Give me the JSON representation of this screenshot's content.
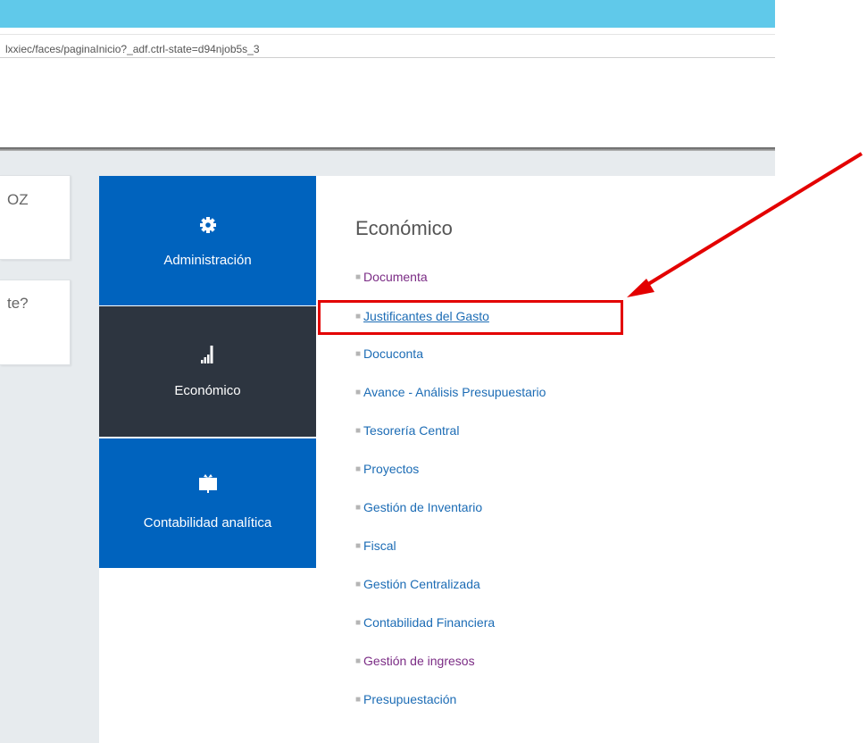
{
  "browser": {
    "url": "lxxiec/faces/paginaInicio?_adf.ctrl-state=d94njob5s_3"
  },
  "side_cards": {
    "card1_text": "OZ",
    "card2_text": "te?"
  },
  "tiles": [
    {
      "label": "Administración",
      "icon": "gear-icon"
    },
    {
      "label": "Económico",
      "icon": "signal-bars-icon"
    },
    {
      "label": "Contabilidad analítica",
      "icon": "monitor-icon"
    }
  ],
  "section": {
    "title": "Económico",
    "items": [
      {
        "label": "Documenta",
        "visited": true
      },
      {
        "label": "Justificantes del Gasto",
        "visited": false,
        "underlined": true
      },
      {
        "label": "Docuconta",
        "visited": false
      },
      {
        "label": "Avance - Análisis Presupuestario",
        "visited": false
      },
      {
        "label": "Tesorería Central",
        "visited": false
      },
      {
        "label": "Proyectos",
        "visited": false
      },
      {
        "label": "Gestión de Inventario",
        "visited": false
      },
      {
        "label": "Fiscal",
        "visited": false
      },
      {
        "label": "Gestión Centralizada",
        "visited": false
      },
      {
        "label": "Contabilidad Financiera",
        "visited": false
      },
      {
        "label": "Gestión de ingresos",
        "visited": true
      },
      {
        "label": "Presupuestación",
        "visited": false
      }
    ]
  },
  "colors": {
    "tile_blue": "#0063be",
    "tile_dark": "#2d3540",
    "link_blue": "#1c6cb5",
    "link_visited": "#7b2c85",
    "annotation_red": "#e30000"
  }
}
